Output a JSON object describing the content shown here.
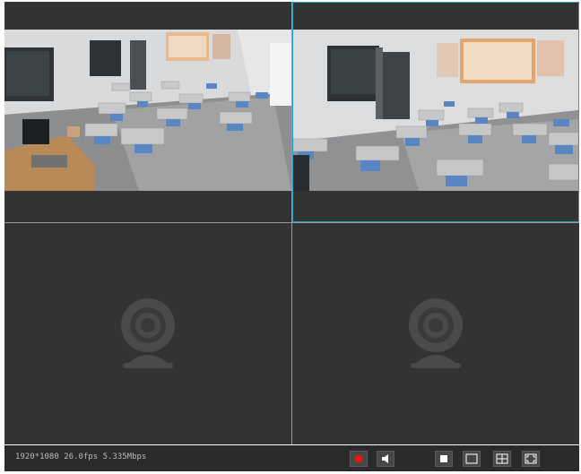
{
  "status": {
    "resolution": "1920*1080",
    "fps": "26.0fps",
    "bitrate": "5.335Mbps"
  },
  "panes": [
    {
      "state": "live",
      "content": "classroom-camera-feed"
    },
    {
      "state": "live-selected",
      "content": "classroom-camera-feed"
    },
    {
      "state": "empty",
      "icon": "camera-placeholder-icon"
    },
    {
      "state": "empty",
      "icon": "camera-placeholder-icon"
    }
  ],
  "toolbar": {
    "buttons": [
      "record-icon",
      "audio-icon",
      "single-layout-icon",
      "one-window-icon",
      "four-window-icon",
      "fullscreen-icon"
    ]
  },
  "colors": {
    "pane_bg": "#333333",
    "selected_border": "#2a9fc6",
    "record": "#e01818",
    "statusbar_bg": "#2b2b2b"
  }
}
